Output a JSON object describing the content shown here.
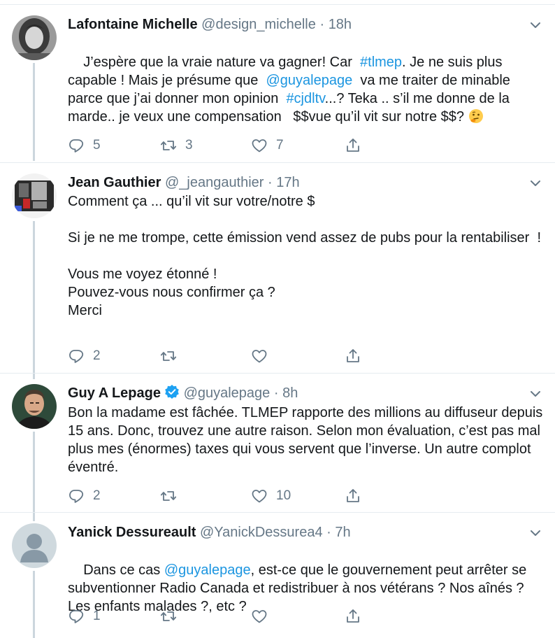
{
  "tweets": [
    {
      "name": "Lafontaine Michelle",
      "handle": "@design_michelle",
      "dot": "·",
      "time": "18h",
      "body": [
        {
          "t": "J’espère que la vraie nature va gagner! Car  "
        },
        {
          "t": "#tlmep",
          "hl": true
        },
        {
          "t": ". Je ne suis plus capable ! Mais je présume que  "
        },
        {
          "t": "@guyalepage",
          "hl": true
        },
        {
          "t": "  va me traiter de minable parce que j’ai donner mon opinion  "
        },
        {
          "t": "#cjdltv",
          "hl": true
        },
        {
          "t": "...? Teka .. s’il me donne de la marde.. je veux une compensation   $$vue qu’il vit sur notre $$? "
        }
      ],
      "emoji": "thinking-face",
      "replies": "5",
      "retweets": "3",
      "likes": "7"
    },
    {
      "name": "Jean Gauthier",
      "handle": "@_jeangauthier",
      "dot": "·",
      "time": "17h",
      "body": [
        {
          "t": "Comment ça ... qu’il vit sur votre/notre $\n\nSi je ne me trompe, cette émission vend assez de pubs pour la rentabiliser  !\n\nVous me voyez étonné !\nPouvez-vous nous confirmer ça ?\nMerci"
        }
      ],
      "replies": "2",
      "retweets": "",
      "likes": ""
    },
    {
      "name": "Guy A Lepage",
      "handle": "@guyalepage",
      "dot": "·",
      "time": "8h",
      "verified": true,
      "body": [
        {
          "t": "Bon la madame est fâchée. TLMEP rapporte des millions au diffuseur depuis 15 ans. Donc, trouvez une autre raison. Selon mon évaluation, c’est pas mal plus mes (énormes) taxes qui vous servent que l’inverse. Un autre complot éventré."
        }
      ],
      "replies": "2",
      "retweets": "",
      "likes": "10"
    },
    {
      "name": "Yanick Dessureault",
      "handle": "@YanickDessurea4",
      "dot": "·",
      "time": "7h",
      "body": [
        {
          "t": "Dans ce cas "
        },
        {
          "t": "@guyalepage",
          "hl": true
        },
        {
          "t": ", est-ce que le gouvernement peut arrêter se subventionner Radio Canada et redistribuer à nos vétérans ? Nos aînés ? Les enfants malades ?, etc ?"
        }
      ],
      "replies": "1",
      "retweets": "",
      "likes": ""
    }
  ],
  "colors": {
    "text": "#14171a",
    "secondary": "#657786",
    "link": "#1b95e0",
    "verified": "#1da1f2",
    "thread_line": "#ccd6dd",
    "divider": "#e6ecf0"
  }
}
